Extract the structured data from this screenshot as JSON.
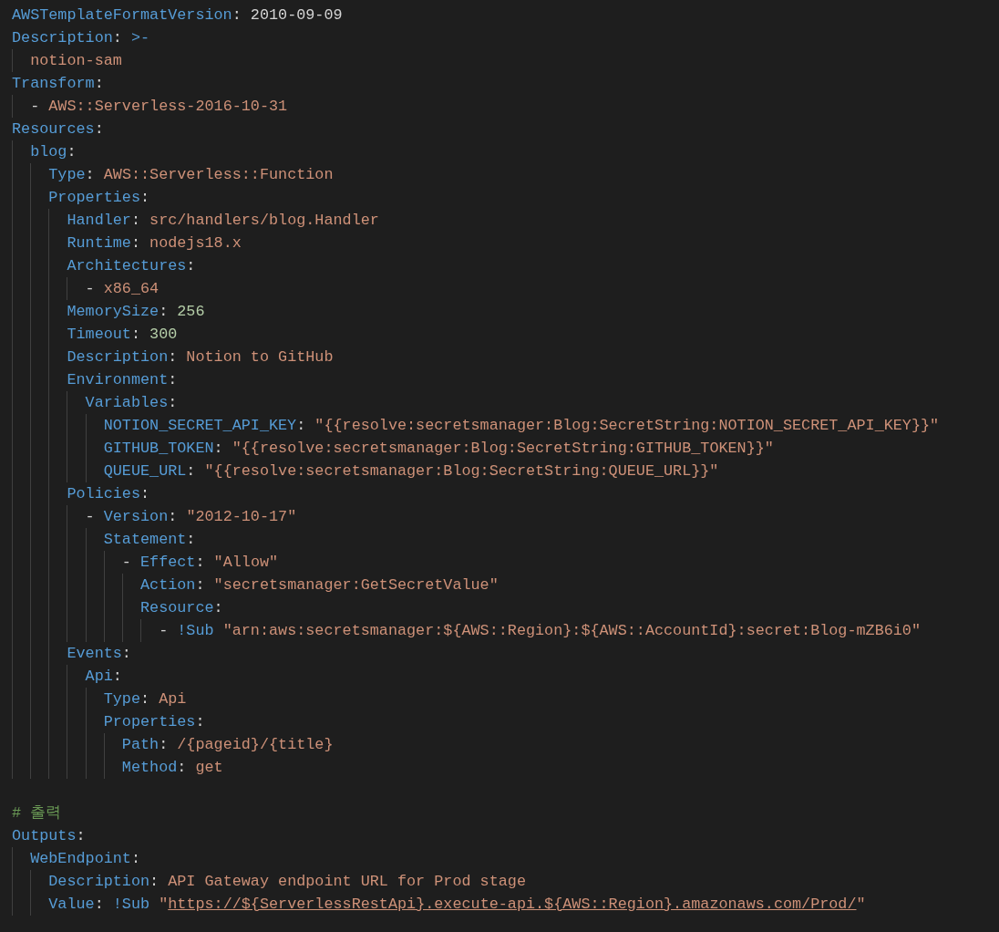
{
  "editor": {
    "blocks": [
      {
        "lines": [
          {
            "tokens": [
              {
                "kind": "key",
                "text": "AWSTemplateFormatVersion"
              },
              {
                "kind": "punct",
                "text": ": "
              },
              {
                "kind": "plain",
                "text": "2010-09-09"
              }
            ]
          },
          {
            "tokens": [
              {
                "kind": "key",
                "text": "Description"
              },
              {
                "kind": "punct",
                "text": ": "
              },
              {
                "kind": "indicator",
                "text": ">-"
              }
            ],
            "children": [
              {
                "tokens": [
                  {
                    "kind": "str",
                    "text": "notion-sam"
                  }
                ]
              }
            ]
          },
          {
            "tokens": [
              {
                "kind": "key",
                "text": "Transform"
              },
              {
                "kind": "punct",
                "text": ":"
              }
            ],
            "children": [
              {
                "tokens": [
                  {
                    "kind": "punct",
                    "text": "- "
                  },
                  {
                    "kind": "str",
                    "text": "AWS::Serverless-2016-10-31"
                  }
                ]
              }
            ]
          },
          {
            "tokens": [
              {
                "kind": "key",
                "text": "Resources"
              },
              {
                "kind": "punct",
                "text": ":"
              }
            ],
            "children": [
              {
                "tokens": [
                  {
                    "kind": "key",
                    "text": "blog"
                  },
                  {
                    "kind": "punct",
                    "text": ":"
                  }
                ],
                "children": [
                  {
                    "tokens": [
                      {
                        "kind": "key",
                        "text": "Type"
                      },
                      {
                        "kind": "punct",
                        "text": ": "
                      },
                      {
                        "kind": "str",
                        "text": "AWS::Serverless::Function"
                      }
                    ]
                  },
                  {
                    "tokens": [
                      {
                        "kind": "key",
                        "text": "Properties"
                      },
                      {
                        "kind": "punct",
                        "text": ":"
                      }
                    ],
                    "children": [
                      {
                        "tokens": [
                          {
                            "kind": "key",
                            "text": "Handler"
                          },
                          {
                            "kind": "punct",
                            "text": ": "
                          },
                          {
                            "kind": "str",
                            "text": "src/handlers/blog.Handler"
                          }
                        ]
                      },
                      {
                        "tokens": [
                          {
                            "kind": "key",
                            "text": "Runtime"
                          },
                          {
                            "kind": "punct",
                            "text": ": "
                          },
                          {
                            "kind": "str",
                            "text": "nodejs18.x"
                          }
                        ]
                      },
                      {
                        "tokens": [
                          {
                            "kind": "key",
                            "text": "Architectures"
                          },
                          {
                            "kind": "punct",
                            "text": ":"
                          }
                        ],
                        "children": [
                          {
                            "tokens": [
                              {
                                "kind": "punct",
                                "text": "- "
                              },
                              {
                                "kind": "str",
                                "text": "x86_64"
                              }
                            ]
                          }
                        ]
                      },
                      {
                        "tokens": [
                          {
                            "kind": "key",
                            "text": "MemorySize"
                          },
                          {
                            "kind": "punct",
                            "text": ": "
                          },
                          {
                            "kind": "num",
                            "text": "256"
                          }
                        ]
                      },
                      {
                        "tokens": [
                          {
                            "kind": "key",
                            "text": "Timeout"
                          },
                          {
                            "kind": "punct",
                            "text": ": "
                          },
                          {
                            "kind": "num",
                            "text": "300"
                          }
                        ]
                      },
                      {
                        "tokens": [
                          {
                            "kind": "key",
                            "text": "Description"
                          },
                          {
                            "kind": "punct",
                            "text": ": "
                          },
                          {
                            "kind": "str",
                            "text": "Notion to GitHub"
                          }
                        ]
                      },
                      {
                        "tokens": [
                          {
                            "kind": "key",
                            "text": "Environment"
                          },
                          {
                            "kind": "punct",
                            "text": ":"
                          }
                        ],
                        "children": [
                          {
                            "tokens": [
                              {
                                "kind": "key",
                                "text": "Variables"
                              },
                              {
                                "kind": "punct",
                                "text": ":"
                              }
                            ],
                            "children": [
                              {
                                "tokens": [
                                  {
                                    "kind": "key",
                                    "text": "NOTION_SECRET_API_KEY"
                                  },
                                  {
                                    "kind": "punct",
                                    "text": ": "
                                  },
                                  {
                                    "kind": "str",
                                    "text": "\"{{resolve:secretsmanager:Blog:SecretString:NOTION_SECRET_API_KEY}}\""
                                  }
                                ]
                              },
                              {
                                "tokens": [
                                  {
                                    "kind": "key",
                                    "text": "GITHUB_TOKEN"
                                  },
                                  {
                                    "kind": "punct",
                                    "text": ": "
                                  },
                                  {
                                    "kind": "str",
                                    "text": "\"{{resolve:secretsmanager:Blog:SecretString:GITHUB_TOKEN}}\""
                                  }
                                ]
                              },
                              {
                                "tokens": [
                                  {
                                    "kind": "key",
                                    "text": "QUEUE_URL"
                                  },
                                  {
                                    "kind": "punct",
                                    "text": ": "
                                  },
                                  {
                                    "kind": "str",
                                    "text": "\"{{resolve:secretsmanager:Blog:SecretString:QUEUE_URL}}\""
                                  }
                                ]
                              }
                            ]
                          }
                        ]
                      },
                      {
                        "tokens": [
                          {
                            "kind": "key",
                            "text": "Policies"
                          },
                          {
                            "kind": "punct",
                            "text": ":"
                          }
                        ],
                        "children": [
                          {
                            "tokens": [
                              {
                                "kind": "punct",
                                "text": "- "
                              },
                              {
                                "kind": "key",
                                "text": "Version"
                              },
                              {
                                "kind": "punct",
                                "text": ": "
                              },
                              {
                                "kind": "str",
                                "text": "\"2012-10-17\""
                              }
                            ],
                            "children": [
                              {
                                "tokens": [
                                  {
                                    "kind": "key",
                                    "text": "Statement"
                                  },
                                  {
                                    "kind": "punct",
                                    "text": ":"
                                  }
                                ],
                                "children": [
                                  {
                                    "tokens": [
                                      {
                                        "kind": "punct",
                                        "text": "- "
                                      },
                                      {
                                        "kind": "key",
                                        "text": "Effect"
                                      },
                                      {
                                        "kind": "punct",
                                        "text": ": "
                                      },
                                      {
                                        "kind": "str",
                                        "text": "\"Allow\""
                                      }
                                    ],
                                    "children": [
                                      {
                                        "tokens": [
                                          {
                                            "kind": "key",
                                            "text": "Action"
                                          },
                                          {
                                            "kind": "punct",
                                            "text": ": "
                                          },
                                          {
                                            "kind": "str",
                                            "text": "\"secretsmanager:GetSecretValue\""
                                          }
                                        ]
                                      },
                                      {
                                        "tokens": [
                                          {
                                            "kind": "key",
                                            "text": "Resource"
                                          },
                                          {
                                            "kind": "punct",
                                            "text": ":"
                                          }
                                        ],
                                        "children": [
                                          {
                                            "tokens": [
                                              {
                                                "kind": "punct",
                                                "text": "- "
                                              },
                                              {
                                                "kind": "tag",
                                                "text": "!Sub "
                                              },
                                              {
                                                "kind": "str",
                                                "text": "\"arn:aws:secretsmanager:${AWS::Region}:${AWS::AccountId}:secret:Blog-mZB6i0\""
                                              }
                                            ]
                                          }
                                        ]
                                      }
                                    ]
                                  }
                                ]
                              }
                            ]
                          }
                        ]
                      },
                      {
                        "tokens": [
                          {
                            "kind": "key",
                            "text": "Events"
                          },
                          {
                            "kind": "punct",
                            "text": ":"
                          }
                        ],
                        "children": [
                          {
                            "tokens": [
                              {
                                "kind": "key",
                                "text": "Api"
                              },
                              {
                                "kind": "punct",
                                "text": ":"
                              }
                            ],
                            "children": [
                              {
                                "tokens": [
                                  {
                                    "kind": "key",
                                    "text": "Type"
                                  },
                                  {
                                    "kind": "punct",
                                    "text": ": "
                                  },
                                  {
                                    "kind": "str",
                                    "text": "Api"
                                  }
                                ]
                              },
                              {
                                "tokens": [
                                  {
                                    "kind": "key",
                                    "text": "Properties"
                                  },
                                  {
                                    "kind": "punct",
                                    "text": ":"
                                  }
                                ],
                                "children": [
                                  {
                                    "tokens": [
                                      {
                                        "kind": "key",
                                        "text": "Path"
                                      },
                                      {
                                        "kind": "punct",
                                        "text": ": "
                                      },
                                      {
                                        "kind": "str",
                                        "text": "/{pageid}/{title}"
                                      }
                                    ]
                                  },
                                  {
                                    "tokens": [
                                      {
                                        "kind": "key",
                                        "text": "Method"
                                      },
                                      {
                                        "kind": "punct",
                                        "text": ": "
                                      },
                                      {
                                        "kind": "str",
                                        "text": "get"
                                      }
                                    ]
                                  }
                                ]
                              }
                            ]
                          }
                        ]
                      }
                    ]
                  }
                ]
              }
            ]
          }
        ]
      },
      {
        "lines": [
          {
            "tokens": [
              {
                "kind": "comment",
                "text": "# 출력"
              }
            ]
          },
          {
            "tokens": [
              {
                "kind": "key",
                "text": "Outputs"
              },
              {
                "kind": "punct",
                "text": ":"
              }
            ],
            "children": [
              {
                "tokens": [
                  {
                    "kind": "key",
                    "text": "WebEndpoint"
                  },
                  {
                    "kind": "punct",
                    "text": ":"
                  }
                ],
                "children": [
                  {
                    "tokens": [
                      {
                        "kind": "key",
                        "text": "Description"
                      },
                      {
                        "kind": "punct",
                        "text": ": "
                      },
                      {
                        "kind": "str",
                        "text": "API Gateway endpoint URL for Prod stage"
                      }
                    ]
                  },
                  {
                    "tokens": [
                      {
                        "kind": "key",
                        "text": "Value"
                      },
                      {
                        "kind": "punct",
                        "text": ": "
                      },
                      {
                        "kind": "tag",
                        "text": "!Sub "
                      },
                      {
                        "kind": "str",
                        "text": "\""
                      },
                      {
                        "kind": "link",
                        "text": "https://${ServerlessRestApi}.execute-api.${AWS::Region}.amazonaws.com/Prod/"
                      },
                      {
                        "kind": "str",
                        "text": "\""
                      }
                    ]
                  }
                ]
              }
            ]
          }
        ]
      }
    ]
  }
}
